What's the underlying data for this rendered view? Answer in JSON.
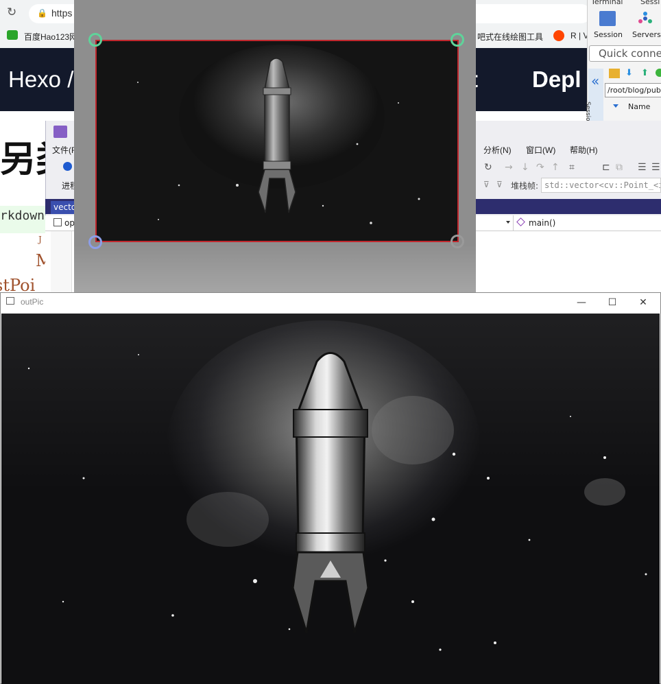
{
  "browser": {
    "url": "https",
    "lock_glyph": "🔒",
    "reload_glyph": "↻",
    "bookmarks": [
      {
        "label": "百度Hao123网"
      },
      {
        "label": "吧式在线绘图工具"
      },
      {
        "label": "R | V"
      }
    ],
    "hexo_nav": {
      "left": "Hexo /",
      "mid": "t",
      "right": "Depl"
    },
    "page_heading": "另类",
    "code_chip": "rkdown",
    "serif_fragments": [
      "J",
      "M",
      "stPoi"
    ]
  },
  "xshell": {
    "tabs": [
      "Terminal",
      "Sessi"
    ],
    "session_label": "Session",
    "servers_label": "Servers",
    "quick_connect": "Quick conne",
    "path": "/root/blog/public",
    "side_label": "Sessions",
    "name_col": "Name",
    "collapse_glyph": "«"
  },
  "vs": {
    "menu": [
      "文件(F)",
      "分析(N)",
      "窗口(W)",
      "帮助(H)"
    ],
    "process_label": "进程",
    "stack_label": "堆栈帧:",
    "stack_value": "std::vector<cv::Point_<int>,std",
    "tab_label": "vecto",
    "file_label": "op",
    "func_label": "main()"
  },
  "outpic": {
    "title": "outPic",
    "min_glyph": "—",
    "max_glyph": "☐",
    "close_glyph": "✕"
  },
  "colors": {
    "hexo_bg": "#13192b",
    "vs_accent": "#2d2d6e",
    "crop_border": "#c0272d",
    "handle_tl": "#5fd39a",
    "handle_tr": "#5fd39a",
    "handle_bl": "#8c9ee8",
    "handle_br": "#9a9a9a"
  }
}
